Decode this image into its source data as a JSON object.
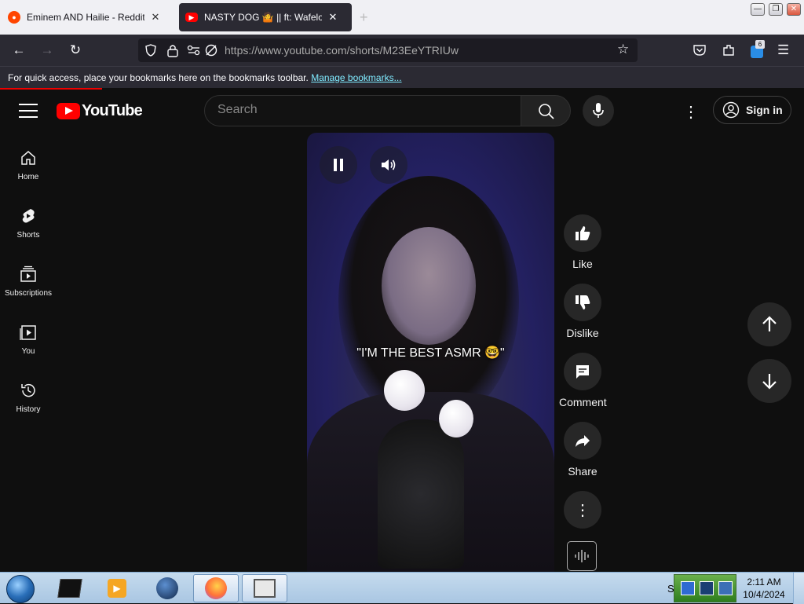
{
  "browser": {
    "tabs": [
      {
        "title": "Eminem AND Hailie - Reddit Se",
        "active": false,
        "icon": "reddit-icon"
      },
      {
        "title": "NASTY DOG 🤷 || ft: Wafelo || #g",
        "active": true,
        "icon": "youtube-icon"
      }
    ],
    "url": "https://www.youtube.com/shorts/M23EeYTRIUw",
    "extension_badge": "6",
    "bookmarks_message": "For quick access, place your bookmarks here on the bookmarks toolbar.",
    "manage_bookmarks": "Manage bookmarks..."
  },
  "youtube": {
    "logo_text": "YouTube",
    "search_placeholder": "Search",
    "sign_in": "Sign in",
    "sidebar": [
      {
        "label": "Home",
        "icon": "home-icon"
      },
      {
        "label": "Shorts",
        "icon": "shorts-icon"
      },
      {
        "label": "Subscriptions",
        "icon": "subscriptions-icon"
      },
      {
        "label": "You",
        "icon": "you-icon"
      },
      {
        "label": "History",
        "icon": "history-icon"
      }
    ],
    "video": {
      "caption": "\"I'M THE BEST ASMR 🤓\""
    },
    "actions": [
      {
        "label": "Like",
        "icon": "thumbs-up-icon"
      },
      {
        "label": "Dislike",
        "icon": "thumbs-down-icon"
      },
      {
        "label": "Comment",
        "icon": "comment-icon"
      },
      {
        "label": "Share",
        "icon": "share-icon"
      }
    ]
  },
  "taskbar": {
    "time": "2:11 AM",
    "date": "10/4/2024",
    "tray_letter": "S"
  },
  "colors": {
    "yt_red": "#ff0000",
    "bg": "#0f0f0f",
    "browser_chrome": "#2b2a33"
  }
}
